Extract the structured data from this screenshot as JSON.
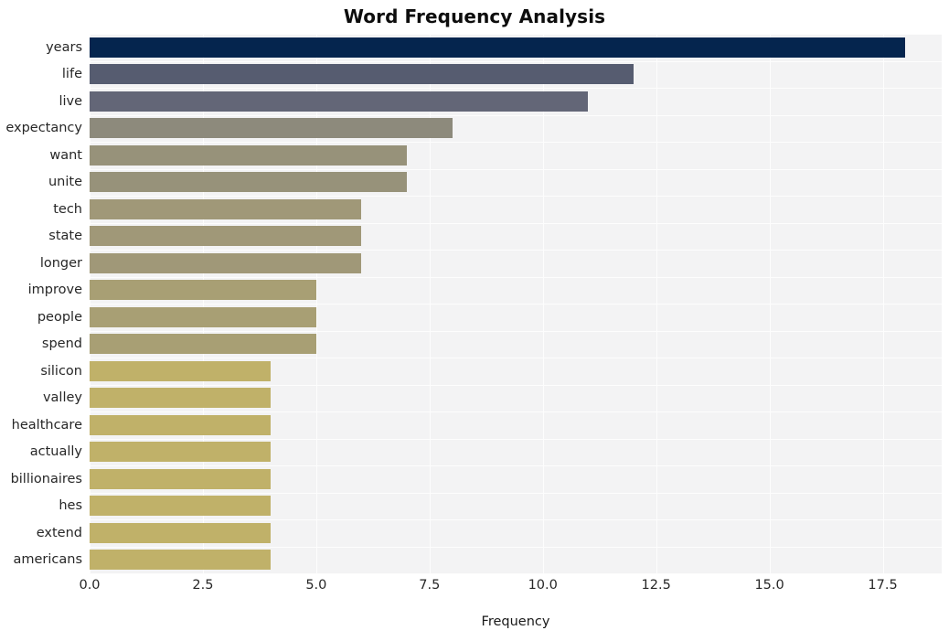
{
  "chart_data": {
    "type": "bar",
    "orientation": "horizontal",
    "title": "Word Frequency Analysis",
    "xlabel": "Frequency",
    "ylabel": "",
    "xlim": [
      0,
      18.8
    ],
    "xticks": [
      0.0,
      2.5,
      5.0,
      7.5,
      10.0,
      12.5,
      15.0,
      17.5
    ],
    "xtick_labels": [
      "0.0",
      "2.5",
      "5.0",
      "7.5",
      "10.0",
      "12.5",
      "15.0",
      "17.5"
    ],
    "grid": true,
    "legend": null,
    "categories": [
      "years",
      "life",
      "live",
      "expectancy",
      "want",
      "unite",
      "tech",
      "state",
      "longer",
      "improve",
      "people",
      "spend",
      "silicon",
      "valley",
      "healthcare",
      "actually",
      "billionaires",
      "hes",
      "extend",
      "americans"
    ],
    "values": [
      18,
      12,
      11,
      8,
      7,
      7,
      6,
      6,
      6,
      5,
      5,
      5,
      4,
      4,
      4,
      4,
      4,
      4,
      4,
      4
    ],
    "bar_colors": [
      "#05254e",
      "#565c70",
      "#636677",
      "#8d8a7c",
      "#97927a",
      "#97927a",
      "#a09878",
      "#a09878",
      "#a09878",
      "#a89f74",
      "#a89f74",
      "#a89f74",
      "#c0b169",
      "#c0b169",
      "#c0b169",
      "#c0b169",
      "#c0b169",
      "#c0b169",
      "#c0b169",
      "#c0b169"
    ],
    "plot_background": "#f3f3f4",
    "grid_color": "#fdfdfd",
    "page_background": "#ffffff",
    "title_color": "#0d0d0d",
    "tick_label_color": "#272727"
  }
}
